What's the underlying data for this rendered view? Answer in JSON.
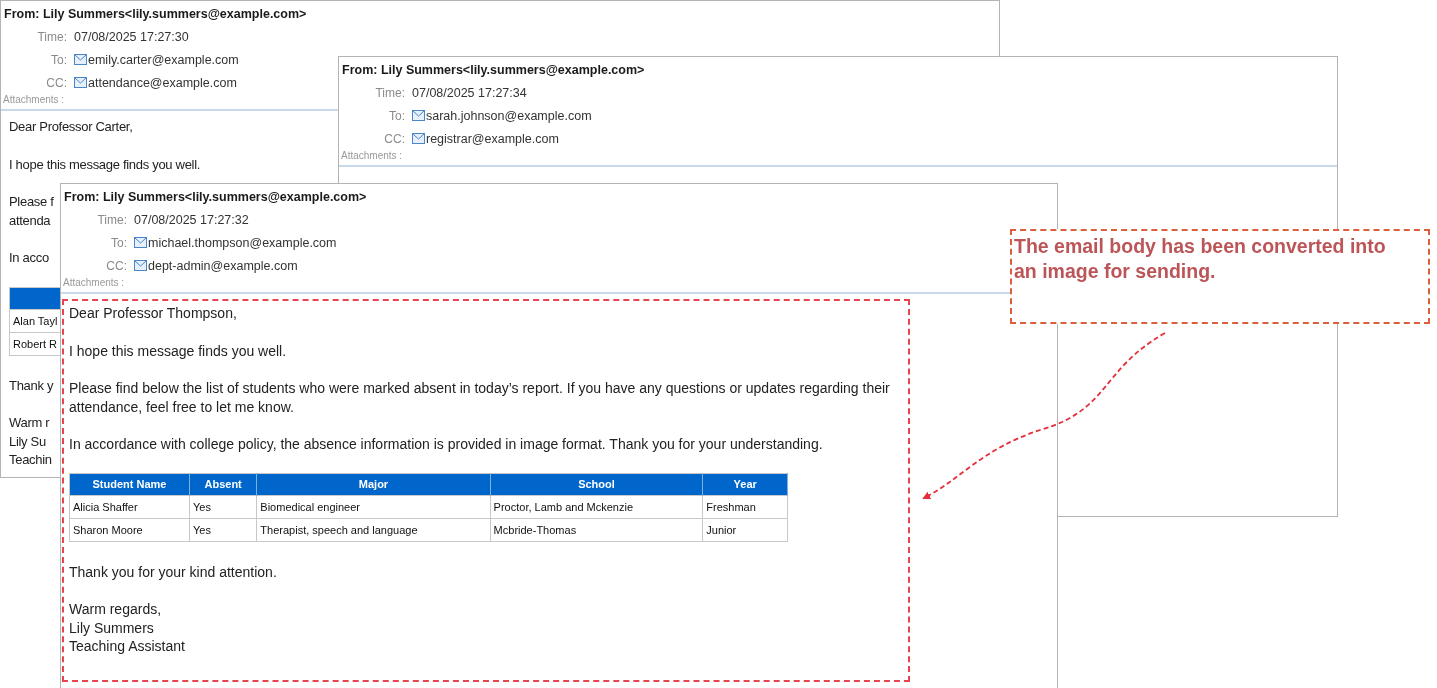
{
  "emails": [
    {
      "from": "From: Lily Summers<lily.summers@example.com>",
      "fields": [
        {
          "label": "Time:",
          "value": "07/08/2025 17:27:30",
          "kind": "text"
        },
        {
          "label": "To:",
          "value": "emily.carter@example.com",
          "kind": "address"
        },
        {
          "label": "CC:",
          "value": "attendance@example.com",
          "kind": "address"
        }
      ],
      "attachments_label": "Attachments :",
      "body": [
        {
          "kind": "paragraph",
          "lines": [
            "Dear Professor Carter,"
          ]
        },
        {
          "kind": "paragraph",
          "lines": [
            "I hope this message finds you well."
          ]
        },
        {
          "kind": "paragraph",
          "lines": [
            "Please f",
            "attenda"
          ]
        },
        {
          "kind": "paragraph",
          "lines": [
            "In acco"
          ]
        },
        {
          "kind": "table",
          "rows": [
            [
              "Alan Tayl"
            ],
            [
              "Robert R"
            ]
          ]
        },
        {
          "kind": "paragraph",
          "lines": [
            "Thank y"
          ]
        },
        {
          "kind": "paragraph",
          "lines": [
            "Warm r",
            "Lily Su",
            "Teachin"
          ]
        }
      ]
    },
    {
      "from": "From: Lily Summers<lily.summers@example.com>",
      "fields": [
        {
          "label": "Time:",
          "value": "07/08/2025 17:27:34",
          "kind": "text"
        },
        {
          "label": "To:",
          "value": "sarah.johnson@example.com",
          "kind": "address"
        },
        {
          "label": "CC:",
          "value": "registrar@example.com",
          "kind": "address"
        }
      ],
      "attachments_label": "Attachments :"
    },
    {
      "from": "From: Lily Summers<lily.summers@example.com>",
      "fields": [
        {
          "label": "Time:",
          "value": "07/08/2025 17:27:32",
          "kind": "text"
        },
        {
          "label": "To:",
          "value": "michael.thompson@example.com",
          "kind": "address"
        },
        {
          "label": "CC:",
          "value": "dept-admin@example.com",
          "kind": "address"
        }
      ],
      "attachments_label": "Attachments :",
      "highlighted": true,
      "body": [
        {
          "kind": "paragraph",
          "lines": [
            "Dear Professor Thompson,"
          ]
        },
        {
          "kind": "paragraph",
          "lines": [
            "I hope this message finds you well."
          ]
        },
        {
          "kind": "paragraph",
          "lines": [
            "Please find below the list of students who were marked absent in today’s report. If you have any questions or updates regarding their",
            "attendance, feel free to let me know."
          ]
        },
        {
          "kind": "paragraph",
          "lines": [
            "In accordance with college policy, the absence information is provided in image format. Thank you for your understanding."
          ]
        },
        {
          "kind": "table",
          "columns": [
            "Student Name",
            "Absent",
            "Major",
            "School",
            "Year"
          ],
          "rows": [
            [
              "Alicia Shaffer",
              "Yes",
              "Biomedical engineer",
              "Proctor, Lamb and Mckenzie",
              "Freshman"
            ],
            [
              "Sharon Moore",
              "Yes",
              "Therapist, speech and language",
              "Mcbride-Thomas",
              "Junior"
            ]
          ]
        },
        {
          "kind": "paragraph",
          "lines": [
            "Thank you for your kind attention."
          ]
        },
        {
          "kind": "paragraph",
          "lines": [
            "Warm regards,",
            "Lily Summers",
            "Teaching Assistant"
          ]
        }
      ]
    }
  ],
  "callout": {
    "lines": [
      "The email body has been converted into",
      "an image for sending."
    ]
  }
}
